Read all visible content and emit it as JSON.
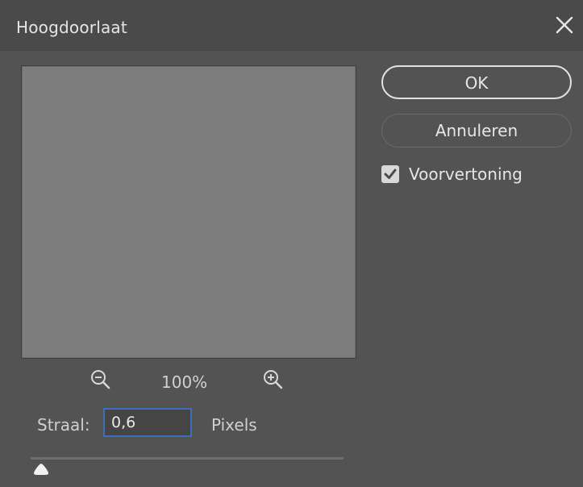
{
  "window": {
    "title": "Hoogdoorlaat"
  },
  "buttons": {
    "ok_label": "OK",
    "cancel_label": "Annuleren"
  },
  "preview_option": {
    "label": "Voorvertoning",
    "checked": true
  },
  "zoom": {
    "level": "100%"
  },
  "radius": {
    "label": "Straal:",
    "value": "0,6",
    "unit": "Pixels"
  },
  "slider": {
    "position_fraction": 0.03
  },
  "icons": {
    "close": "close-icon",
    "zoom_out": "zoom-out-icon",
    "zoom_in": "zoom-in-icon",
    "check": "checkmark-icon"
  },
  "colors": {
    "dialog_bg": "#535353",
    "titlebar_bg": "#4a4a4a",
    "preview_bg": "#7d7d7d",
    "input_focus": "#3d6fb8",
    "text": "#e6e6e6"
  }
}
